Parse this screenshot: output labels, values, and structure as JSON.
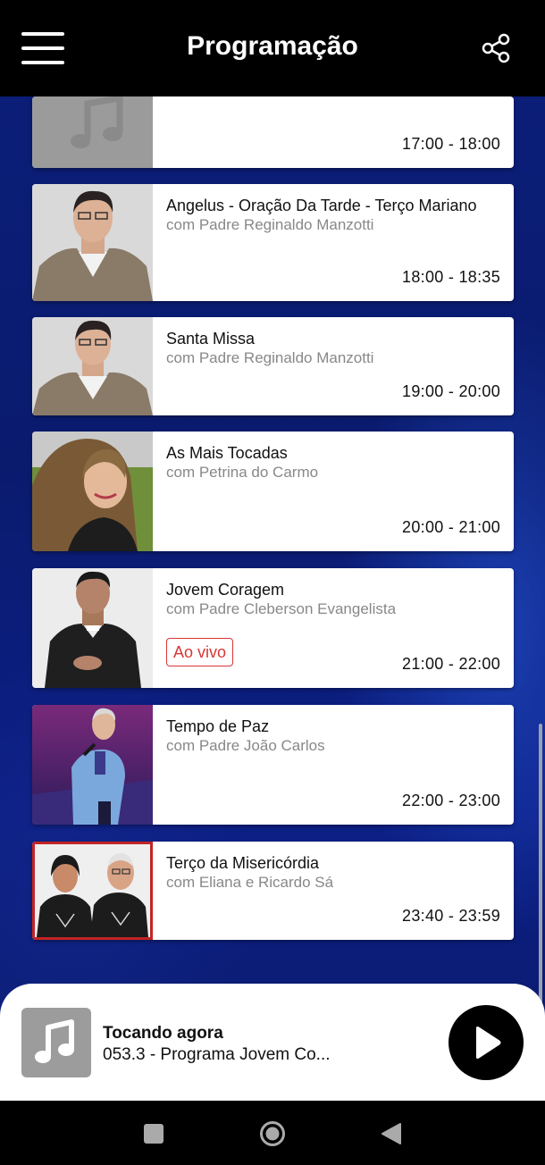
{
  "header": {
    "title": "Programação"
  },
  "schedule": [
    {
      "title": "",
      "host": "",
      "time": "17:00 - 18:00",
      "thumb": "music-placeholder-icon"
    },
    {
      "title": "Angelus - Oração Da Tarde - Terço Mariano",
      "host": "com Padre Reginaldo Manzotti",
      "time": "18:00 - 18:35",
      "thumb": "host-photo-priest"
    },
    {
      "title": "Santa Missa",
      "host": "com Padre Reginaldo Manzotti",
      "time": "19:00 - 20:00",
      "thumb": "host-photo-priest"
    },
    {
      "title": "As Mais Tocadas",
      "host": "com Petrina do Carmo",
      "time": "20:00 - 21:00",
      "thumb": "host-photo-woman"
    },
    {
      "title": "Jovem Coragem",
      "host": "com Padre Cleberson Evangelista",
      "time": "21:00 - 22:00",
      "badge": "Ao vivo",
      "thumb": "host-photo-priest-smiling"
    },
    {
      "title": "Tempo de Paz",
      "host": "com Padre João Carlos",
      "time": "22:00 - 23:00",
      "thumb": "host-photo-singer-stage"
    },
    {
      "title": "Terço da Misericórdia",
      "host": "com Eliana e Ricardo Sá",
      "time": "23:40 - 23:59",
      "thumb": "host-photo-duo"
    }
  ],
  "player": {
    "label": "Tocando agora",
    "track": "053.3 - Programa Jovem Co..."
  },
  "colors": {
    "live_badge": "#d93636",
    "background": "#0b1e7a",
    "header": "#000000"
  }
}
